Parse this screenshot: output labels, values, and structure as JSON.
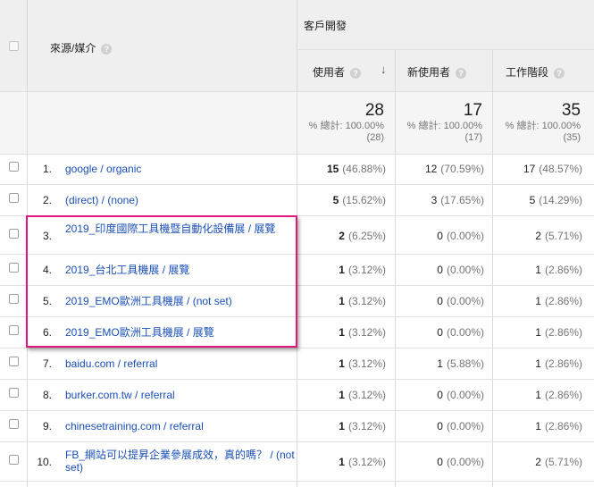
{
  "header": {
    "dimension_label": "來源/媒介",
    "group_label": "客戶開發",
    "col_users": "使用者",
    "col_new_users": "新使用者",
    "col_sessions": "工作階段"
  },
  "totals": {
    "users": "28",
    "users_sub1": "% 總計: 100.00%",
    "users_sub2": "(28)",
    "new_users": "17",
    "new_users_sub1": "% 總計: 100.00%",
    "new_users_sub2": "(17)",
    "sessions": "35",
    "sessions_sub1": "% 總計: 100.00%",
    "sessions_sub2": "(35)"
  },
  "rows": [
    {
      "num": "1.",
      "source": "google / organic",
      "users": "15",
      "users_pct": "(46.88%)",
      "new": "12",
      "new_pct": "(70.59%)",
      "sess": "17",
      "sess_pct": "(48.57%)"
    },
    {
      "num": "2.",
      "source": "(direct) / (none)",
      "users": "5",
      "users_pct": "(15.62%)",
      "new": "3",
      "new_pct": "(17.65%)",
      "sess": "5",
      "sess_pct": "(14.29%)"
    },
    {
      "num": "3.",
      "source": "2019_印度國際工具機暨自動化設備展 / 展覽",
      "users": "2",
      "users_pct": "(6.25%)",
      "new": "0",
      "new_pct": "(0.00%)",
      "sess": "2",
      "sess_pct": "(5.71%)"
    },
    {
      "num": "4.",
      "source": "2019_台北工具機展 / 展覽",
      "users": "1",
      "users_pct": "(3.12%)",
      "new": "0",
      "new_pct": "(0.00%)",
      "sess": "1",
      "sess_pct": "(2.86%)"
    },
    {
      "num": "5.",
      "source": "2019_EMO歐洲工具機展 / (not set)",
      "users": "1",
      "users_pct": "(3.12%)",
      "new": "0",
      "new_pct": "(0.00%)",
      "sess": "1",
      "sess_pct": "(2.86%)"
    },
    {
      "num": "6.",
      "source": "2019_EMO歐洲工具機展 / 展覽",
      "users": "1",
      "users_pct": "(3.12%)",
      "new": "0",
      "new_pct": "(0.00%)",
      "sess": "1",
      "sess_pct": "(2.86%)"
    },
    {
      "num": "7.",
      "source": "baidu.com / referral",
      "users": "1",
      "users_pct": "(3.12%)",
      "new": "1",
      "new_pct": "(5.88%)",
      "sess": "1",
      "sess_pct": "(2.86%)"
    },
    {
      "num": "8.",
      "source": "burker.com.tw / referral",
      "users": "1",
      "users_pct": "(3.12%)",
      "new": "0",
      "new_pct": "(0.00%)",
      "sess": "1",
      "sess_pct": "(2.86%)"
    },
    {
      "num": "9.",
      "source": "chinesetraining.com / referral",
      "users": "1",
      "users_pct": "(3.12%)",
      "new": "0",
      "new_pct": "(0.00%)",
      "sess": "1",
      "sess_pct": "(2.86%)"
    },
    {
      "num": "10.",
      "source": "FB_網站可以提昇企業參展成效，真的嗎？ / (not set)",
      "users": "1",
      "users_pct": "(3.12%)",
      "new": "0",
      "new_pct": "(0.00%)",
      "sess": "2",
      "sess_pct": "(5.71%)"
    }
  ],
  "colors": {
    "link": "#1a4fb5",
    "highlight": "#e0177f",
    "header_bg": "#efefef"
  }
}
